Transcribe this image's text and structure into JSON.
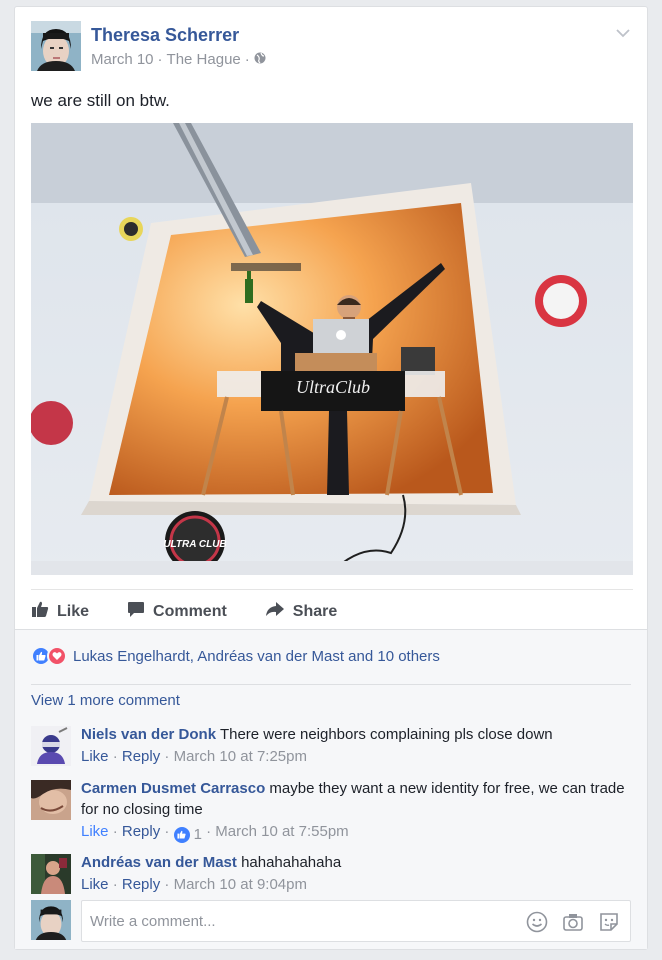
{
  "post": {
    "author": "Theresa Scherrer",
    "date": "March 10",
    "location": "The Hague",
    "separator": "·",
    "text": "we are still on btw."
  },
  "photo": {
    "sign_text": "UltraClub",
    "badge_text": "ULTRA CLUB"
  },
  "actions": {
    "like": "Like",
    "comment": "Comment",
    "share": "Share"
  },
  "reactions": {
    "text": "Lukas Engelhardt, Andréas van der Mast and 10 others"
  },
  "view_more": "View 1 more comment",
  "comments": [
    {
      "author": "Niels van der Donk",
      "text": "There were neighbors complaining pls close down",
      "like": "Like",
      "reply": "Reply",
      "time": "March 10 at 7:25pm"
    },
    {
      "author": "Carmen Dusmet Carrasco",
      "text": "maybe they want a new identity for free, we can trade for no closing time",
      "like": "Like",
      "reply": "Reply",
      "likes_count": "1",
      "time": "March 10 at 7:55pm"
    },
    {
      "author": "Andréas van der Mast",
      "text": "hahahahahaha",
      "like": "Like",
      "reply": "Reply",
      "time": "March 10 at 9:04pm"
    }
  ],
  "composer": {
    "placeholder": "Write a comment..."
  },
  "colors": {
    "link": "#365899",
    "muted": "#90949c",
    "like_blue": "#4080ff",
    "love_red": "#f25268"
  }
}
